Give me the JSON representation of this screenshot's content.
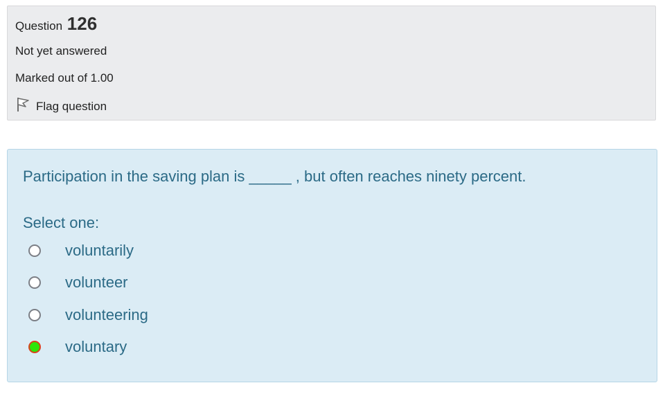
{
  "info": {
    "question_word": "Question",
    "question_number": "126",
    "state": "Not yet answered",
    "grade": "Marked out of 1.00",
    "flag_label": "Flag question",
    "flag_icon": "flag-icon"
  },
  "question": {
    "text": "Participation in the saving plan is _____ , but often reaches ninety percent.",
    "prompt": "Select one:",
    "options": [
      {
        "label": "voluntarily",
        "selected": false
      },
      {
        "label": "volunteer",
        "selected": false
      },
      {
        "label": "volunteering",
        "selected": false
      },
      {
        "label": "voluntary",
        "selected": true
      }
    ]
  },
  "colors": {
    "info_bg": "#ebecee",
    "content_bg": "#dbecf5",
    "text_blue": "#2b6a86",
    "selected_fill": "#2ee60a",
    "selected_ring": "#d8431d"
  }
}
